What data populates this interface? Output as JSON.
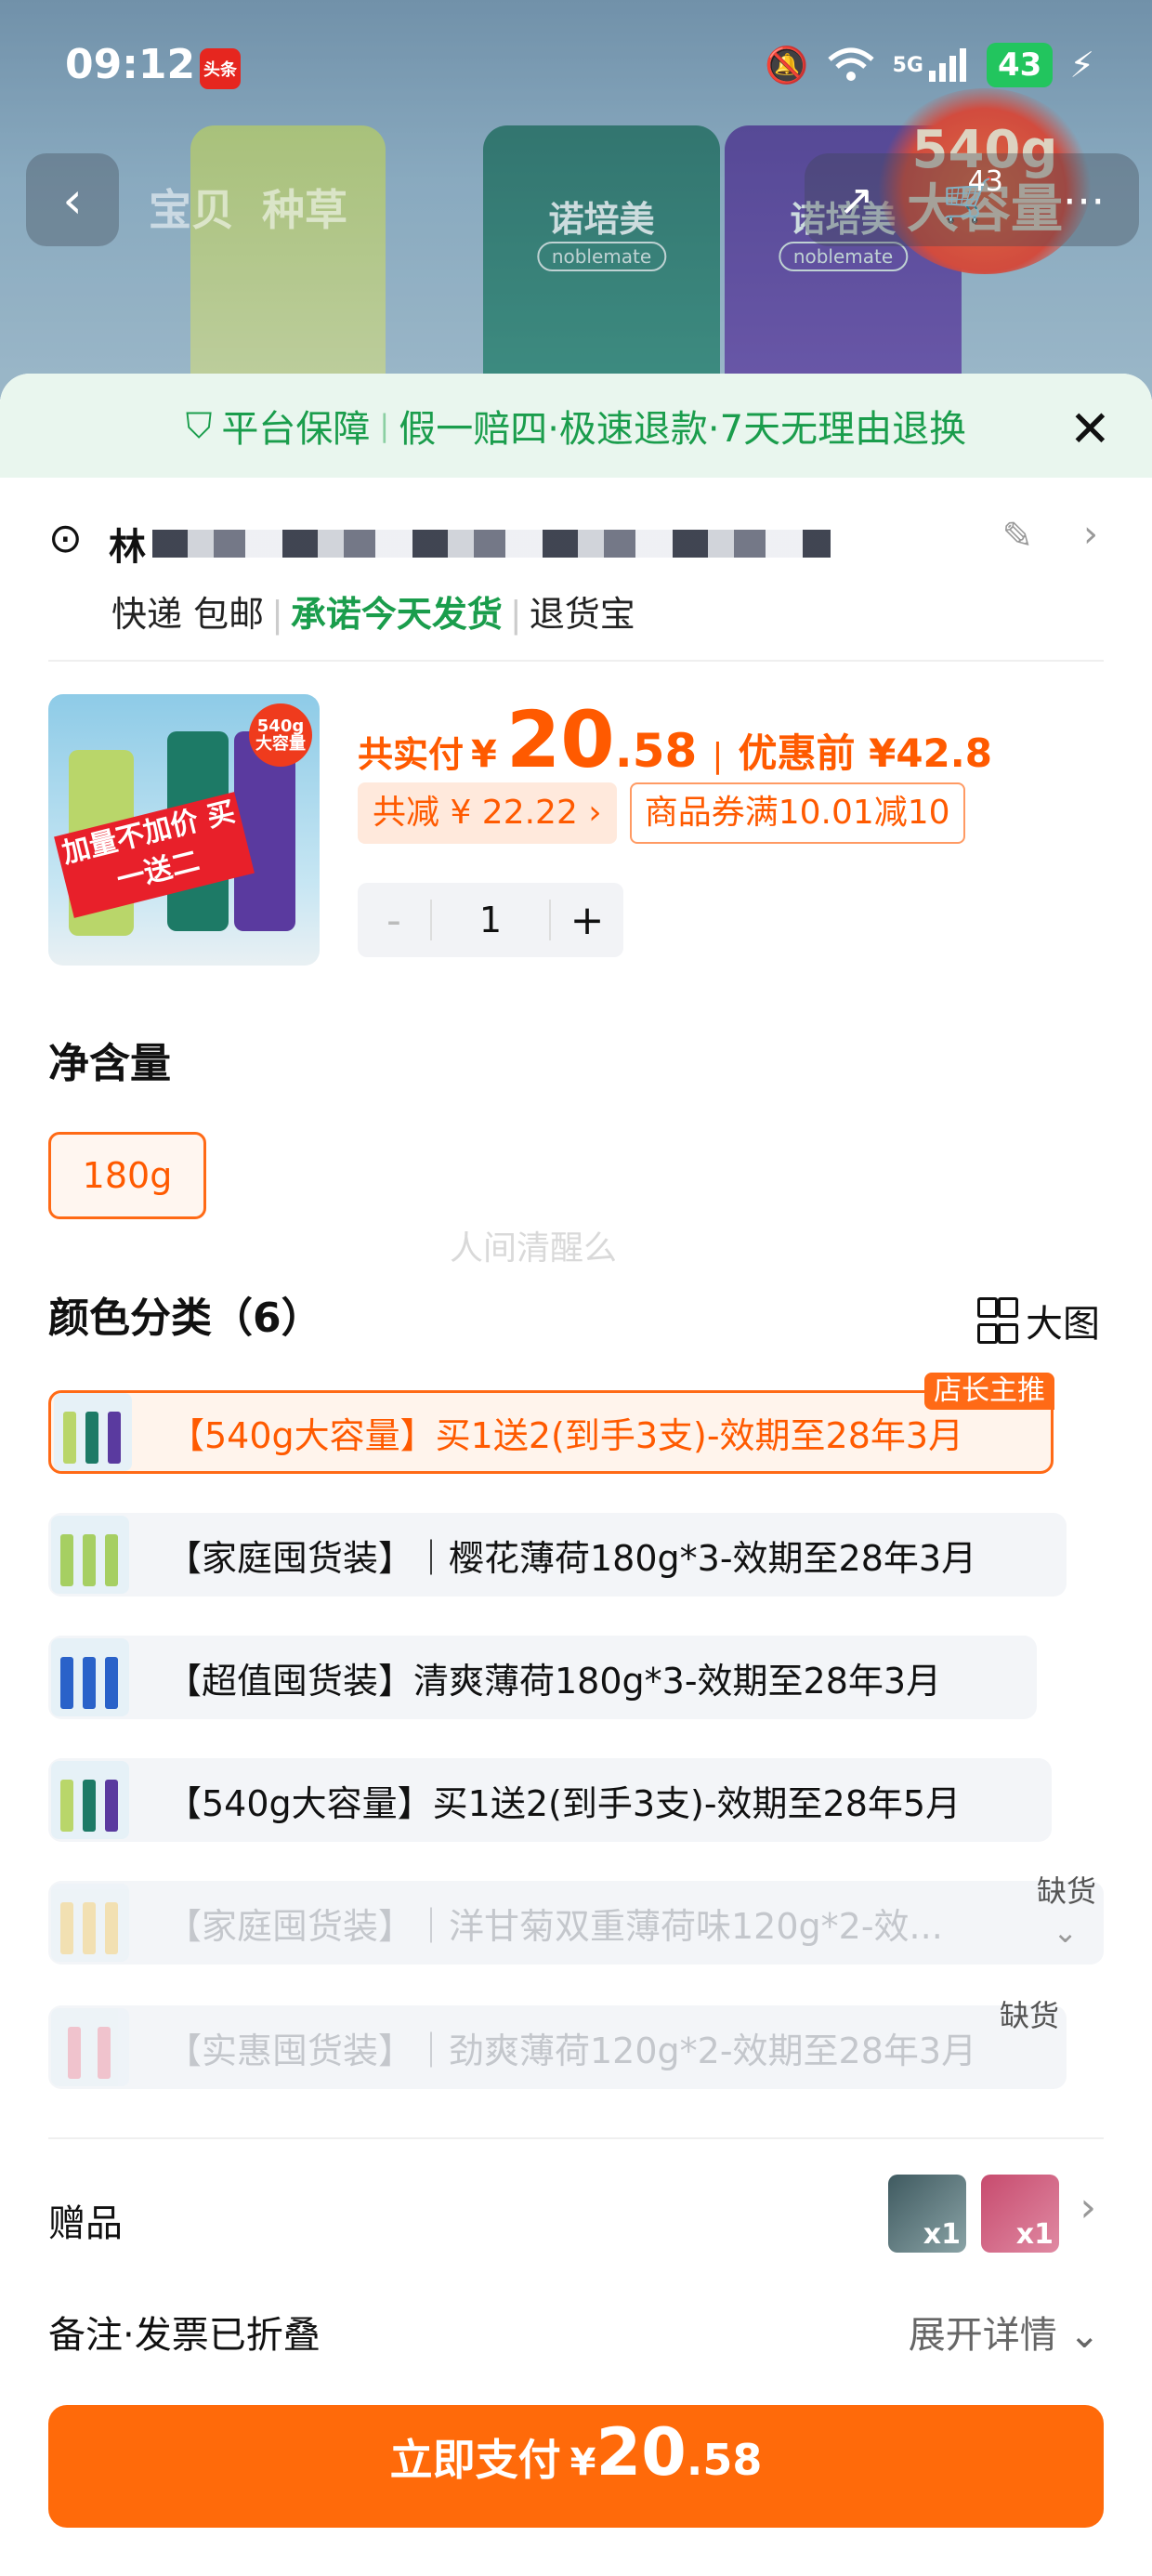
{
  "status_bar": {
    "time": "09:12",
    "app_badge": "头条",
    "network": "5G",
    "battery": "43"
  },
  "nav": {
    "tabs": [
      "宝贝",
      "种草"
    ],
    "cart_count": "43"
  },
  "product_image": {
    "brand": "诺培美",
    "logo": "noblemate",
    "promo": "540g 大容量",
    "ribbon": "加量不加价 买一送二",
    "burst": "540g 大容量",
    "mini_brand": "诺培美"
  },
  "guarantee": {
    "title": "平台保障",
    "items": "假一赔四·极速退款·7天无理由退换"
  },
  "address": {
    "name": "林",
    "delivery": "快递 包邮",
    "promise": "承诺今天发货",
    "return": "退货宝"
  },
  "price": {
    "label": "共实付",
    "yen": "¥",
    "int": "20",
    "dec": ".58",
    "before": "优惠前 ¥42.8",
    "total_cut": "共减 ¥ 22.22 ›",
    "coupon": "商品券满10.01减10"
  },
  "quantity": {
    "minus": "-",
    "value": "1",
    "plus": "+"
  },
  "net": {
    "title": "净含量",
    "option": "180g"
  },
  "watermark": "人间清醒么",
  "color": {
    "title": "颜色分类（6）",
    "big_view": "大图",
    "corner_tag": "店长主推",
    "oos": "缺货",
    "options": [
      {
        "label": "【540g大容量】买1送2(到手3支)-效期至28年3月"
      },
      {
        "label": "【家庭囤货装】｜樱花薄荷180g*3-效期至28年3月"
      },
      {
        "label": "【超值囤货装】清爽薄荷180g*3-效期至28年3月"
      },
      {
        "label": "【540g大容量】买1送2(到手3支)-效期至28年5月"
      },
      {
        "label": "【家庭囤货装】｜洋甘菊双重薄荷味120g*2-效..."
      },
      {
        "label": "【实惠囤货装】｜劲爽薄荷120g*2-效期至28年3月"
      }
    ]
  },
  "gift": {
    "label": "赠品",
    "count1": "x1",
    "count2": "x1"
  },
  "remark": {
    "label": "备注·发票已折叠",
    "expand": "展开详情"
  },
  "pay": {
    "label": "立即支付",
    "yen": "¥",
    "int": "20",
    "dec": ".58"
  },
  "colors": {
    "accent": "#ff6a0a",
    "green": "#1a9d4c"
  }
}
